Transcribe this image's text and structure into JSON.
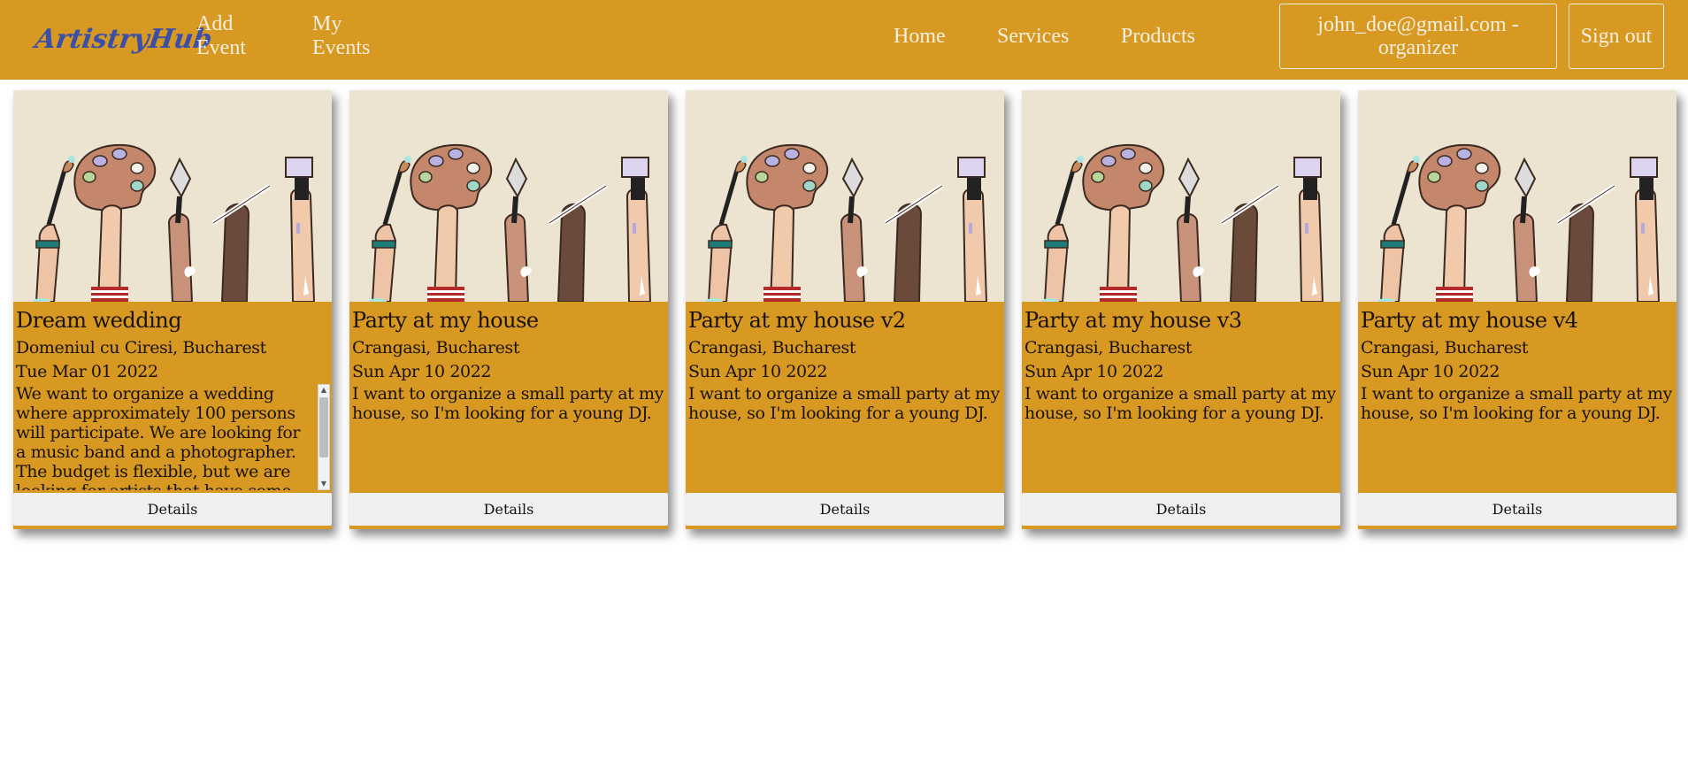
{
  "navbar": {
    "brand": "ArtistryHub",
    "add_event": "Add Event",
    "my_events": "My Events",
    "home": "Home",
    "services": "Services",
    "products": "Products",
    "user": "john_doe@gmail.com - organizer",
    "sign_out": "Sign out"
  },
  "colors": {
    "accent": "#d79922",
    "brand": "#3b4fa8",
    "card_bg": "#d79922",
    "image_bg": "#ece4d0",
    "button_bg": "#efefef"
  },
  "events": [
    {
      "title": "Dream wedding",
      "location": "Domeniul cu Ciresi, Bucharest",
      "date": "Tue Mar 01 2022",
      "description": "We want to organize a wedding where approximately 100 persons will participate. We are looking for a music band and a photographer. The budget is flexible, but we are looking for artists that have some experience",
      "button": "Details"
    },
    {
      "title": "Party at my house",
      "location": "Crangasi, Bucharest",
      "date": "Sun Apr 10 2022",
      "description": "I want to organize a small party at my house, so I'm looking for a young DJ.",
      "button": "Details"
    },
    {
      "title": "Party at my house v2",
      "location": "Crangasi, Bucharest",
      "date": "Sun Apr 10 2022",
      "description": "I want to organize a small party at my house, so I'm looking for a young DJ.",
      "button": "Details"
    },
    {
      "title": "Party at my house v3",
      "location": "Crangasi, Bucharest",
      "date": "Sun Apr 10 2022",
      "description": "I want to organize a small party at my house, so I'm looking for a young DJ.",
      "button": "Details"
    },
    {
      "title": "Party at my house v4",
      "location": "Crangasi, Bucharest",
      "date": "Sun Apr 10 2022",
      "description": "I want to organize a small party at my house, so I'm looking for a young DJ.",
      "button": "Details"
    }
  ]
}
